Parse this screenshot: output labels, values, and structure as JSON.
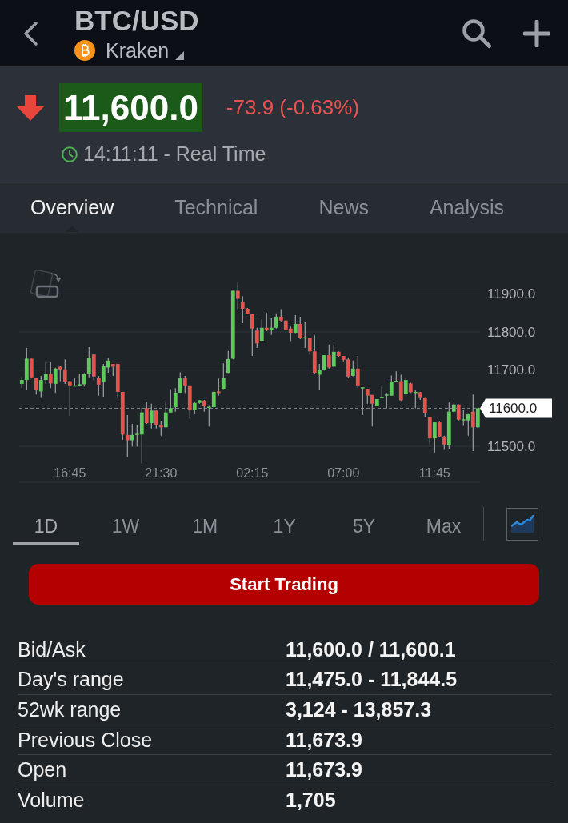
{
  "header": {
    "title": "BTC/USD",
    "exchange": "Kraken"
  },
  "quote": {
    "falling": true,
    "flash": true,
    "price": "11,600.0",
    "change": "-73.9 (-0.63%)",
    "time": "14:11:11 - Real Time"
  },
  "tabs": [
    {
      "label": "Overview",
      "selected": true
    },
    {
      "label": "Technical",
      "selected": false
    },
    {
      "label": "News",
      "selected": false
    },
    {
      "label": "Analysis",
      "selected": false
    }
  ],
  "chart": {
    "chart_data": {
      "type": "candlestick",
      "categories": [
        null,
        null,
        null,
        null,
        null,
        null,
        null,
        null,
        null,
        null,
        "16:45",
        null,
        null,
        null,
        null,
        null,
        null,
        null,
        null,
        null,
        null,
        null,
        null,
        null,
        null,
        null,
        null,
        null,
        null,
        "21:30",
        null,
        null,
        null,
        null,
        null,
        null,
        null,
        null,
        null,
        null,
        null,
        null,
        null,
        null,
        null,
        null,
        null,
        null,
        "02:15",
        null,
        null,
        null,
        null,
        null,
        null,
        null,
        null,
        null,
        null,
        null,
        null,
        null,
        null,
        null,
        null,
        null,
        null,
        "07:00",
        null,
        null,
        null,
        null,
        null,
        null,
        null,
        null,
        null,
        null,
        null,
        null,
        null,
        null,
        null,
        null,
        null,
        null,
        "11:45",
        null,
        null,
        null,
        null,
        null,
        null,
        null,
        null,
        null
      ],
      "ohlc": [
        [
          11664,
          11681,
          11653,
          11674
        ],
        [
          11674,
          11758,
          11647,
          11730
        ],
        [
          11730,
          11730,
          11678,
          11681
        ],
        [
          11679,
          11679,
          11636,
          11647
        ],
        [
          11644,
          11685,
          11629,
          11674
        ],
        [
          11674,
          11720,
          11664,
          11690
        ],
        [
          11690,
          11721,
          11653,
          11665
        ],
        [
          11664,
          11706,
          11640,
          11704
        ],
        [
          11709,
          11711,
          11671,
          11702
        ],
        [
          11702,
          11728,
          11664,
          11670
        ],
        [
          11671,
          11671,
          11580,
          11660
        ],
        [
          11658,
          11679,
          11657,
          11660
        ],
        [
          11659,
          11690,
          11659,
          11663
        ],
        [
          11663,
          11692,
          11657,
          11690
        ],
        [
          11690,
          11760,
          11681,
          11732
        ],
        [
          11741,
          11741,
          11674,
          11683
        ],
        [
          11679,
          11685,
          11633,
          11662
        ],
        [
          11669,
          11716,
          11630,
          11711
        ],
        [
          11707,
          11732,
          11693,
          11725
        ],
        [
          11716,
          11716,
          11685,
          11709
        ],
        [
          11716,
          11716,
          11626,
          11643
        ],
        [
          11643,
          11643,
          11517,
          11531
        ],
        [
          11530,
          11582,
          11472,
          11516
        ],
        [
          11516,
          11559,
          11500,
          11530
        ],
        [
          11530,
          11556,
          11500,
          11533
        ],
        [
          11531,
          11601,
          11455,
          11589
        ],
        [
          11600,
          11617,
          11559,
          11561
        ],
        [
          11561,
          11612,
          11547,
          11594
        ],
        [
          11594,
          11596,
          11547,
          11556
        ],
        [
          11556,
          11566,
          11528,
          11550
        ],
        [
          11550,
          11615,
          11550,
          11589
        ],
        [
          11589,
          11650,
          11589,
          11600
        ],
        [
          11603,
          11653,
          11591,
          11641
        ],
        [
          11641,
          11694,
          11640,
          11680
        ],
        [
          11680,
          11685,
          11640,
          11660
        ],
        [
          11660,
          11660,
          11573,
          11596
        ],
        [
          11596,
          11617,
          11584,
          11614
        ],
        [
          11614,
          11622,
          11612,
          11621
        ],
        [
          11620,
          11622,
          11591,
          11605
        ],
        [
          11601,
          11608,
          11552,
          11604
        ],
        [
          11603,
          11643,
          11601,
          11643
        ],
        [
          11644,
          11678,
          11633,
          11640
        ],
        [
          11651,
          11718,
          11650,
          11680
        ],
        [
          11693,
          11750,
          11692,
          11729
        ],
        [
          11730,
          11908,
          11728,
          11908
        ],
        [
          11908,
          11929,
          11856,
          11887
        ],
        [
          11879,
          11894,
          11823,
          11861
        ],
        [
          11861,
          11863,
          11846,
          11847
        ],
        [
          11847,
          11847,
          11737,
          11809
        ],
        [
          11804,
          11811,
          11758,
          11770
        ],
        [
          11777,
          11833,
          11776,
          11811
        ],
        [
          11811,
          11850,
          11802,
          11804
        ],
        [
          11804,
          11836,
          11792,
          11811
        ],
        [
          11811,
          11849,
          11809,
          11840
        ],
        [
          11840,
          11860,
          11828,
          11830
        ],
        [
          11830,
          11830,
          11804,
          11805
        ],
        [
          11809,
          11814,
          11776,
          11798
        ],
        [
          11798,
          11844,
          11797,
          11821
        ],
        [
          11821,
          11840,
          11781,
          11784
        ],
        [
          11783,
          11825,
          11758,
          11786
        ],
        [
          11784,
          11784,
          11741,
          11749
        ],
        [
          11749,
          11791,
          11690,
          11693
        ],
        [
          11688,
          11716,
          11647,
          11700
        ],
        [
          11700,
          11739,
          11699,
          11739
        ],
        [
          11739,
          11767,
          11704,
          11707
        ],
        [
          11709,
          11767,
          11707,
          11748
        ],
        [
          11748,
          11749,
          11735,
          11737
        ],
        [
          11737,
          11737,
          11723,
          11727
        ],
        [
          11728,
          11732,
          11679,
          11683
        ],
        [
          11685,
          11725,
          11683,
          11704
        ],
        [
          11704,
          11737,
          11653,
          11660
        ],
        [
          11652,
          11655,
          11582,
          11655
        ],
        [
          11651,
          11651,
          11612,
          11633
        ],
        [
          11635,
          11635,
          11552,
          11612
        ],
        [
          11606,
          11624,
          11605,
          11624
        ],
        [
          11628,
          11656,
          11628,
          11630
        ],
        [
          11633,
          11640,
          11600,
          11636
        ],
        [
          11633,
          11686,
          11633,
          11670
        ],
        [
          11670,
          11697,
          11670,
          11672
        ],
        [
          11671,
          11688,
          11619,
          11621
        ],
        [
          11638,
          11678,
          11636,
          11674
        ],
        [
          11665,
          11667,
          11640,
          11642
        ],
        [
          11640,
          11647,
          11600,
          11643
        ],
        [
          11642,
          11643,
          11622,
          11629
        ],
        [
          11628,
          11629,
          11577,
          11587
        ],
        [
          11577,
          11577,
          11505,
          11521
        ],
        [
          11521,
          11563,
          11484,
          11563
        ],
        [
          11563,
          11565,
          11524,
          11526
        ],
        [
          11526,
          11528,
          11491,
          11505
        ],
        [
          11503,
          11615,
          11493,
          11591
        ],
        [
          11591,
          11612,
          11589,
          11610
        ],
        [
          11610,
          11610,
          11568,
          11570
        ],
        [
          11568,
          11596,
          11554,
          11571
        ],
        [
          11568,
          11585,
          11528,
          11584
        ],
        [
          11591,
          11636,
          11488,
          11550
        ],
        [
          11550,
          11600,
          11549,
          11600
        ]
      ],
      "ylim": [
        11406,
        12062
      ],
      "yticks": [
        {
          "value": 11900,
          "label": "11900.0"
        },
        {
          "value": 11800,
          "label": "11800.0"
        },
        {
          "value": 11700,
          "label": "11700.0"
        },
        {
          "value": 11500,
          "label": "11500.0"
        }
      ],
      "grid": true,
      "ref_lines": [
        {
          "axis": "y",
          "value": 11600,
          "label": "11600.0"
        }
      ]
    }
  },
  "periods": [
    {
      "label": "1D",
      "selected": true
    },
    {
      "label": "1W",
      "selected": false
    },
    {
      "label": "1M",
      "selected": false
    },
    {
      "label": "1Y",
      "selected": false
    },
    {
      "label": "5Y",
      "selected": false
    },
    {
      "label": "Max",
      "selected": false
    }
  ],
  "trade_button": "Start Trading",
  "stats": [
    {
      "label": "Bid/Ask",
      "value": "11,600.0 / 11,600.1"
    },
    {
      "label": "Day's range",
      "value": "11,475.0 - 11,844.5"
    },
    {
      "label": "52wk range",
      "value": "3,124 - 13,857.3"
    },
    {
      "label": "Previous Close",
      "value": "11,673.9"
    },
    {
      "label": "Open",
      "value": "11,673.9"
    },
    {
      "label": "Volume",
      "value": "1,705"
    }
  ]
}
